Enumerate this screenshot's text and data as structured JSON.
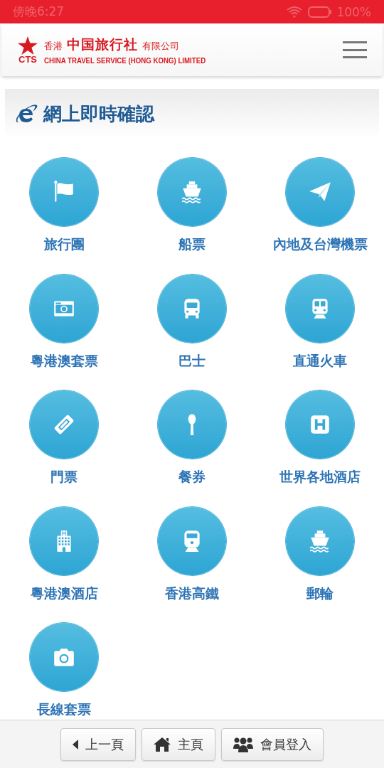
{
  "status_bar": {
    "time": "傍晚6:27",
    "battery": "100%"
  },
  "header": {
    "logo_mark": "CTS",
    "logo_prefix": "香港",
    "logo_name": "中国旅行社",
    "logo_suffix": "有限公司",
    "logo_english": "CHINA TRAVEL SERVICE (HONG KONG) LIMITED"
  },
  "section": {
    "title": "網上即時確認"
  },
  "services": [
    {
      "label": "旅行團",
      "kind": "flag"
    },
    {
      "label": "船票",
      "kind": "ship"
    },
    {
      "label": "內地及台灣機票",
      "kind": "plane"
    },
    {
      "label": "粵港澳套票",
      "kind": "card"
    },
    {
      "label": "巴士",
      "kind": "bus"
    },
    {
      "label": "直通火車",
      "kind": "train"
    },
    {
      "label": "門票",
      "kind": "ticket"
    },
    {
      "label": "餐券",
      "kind": "spoon"
    },
    {
      "label": "世界各地酒店",
      "kind": "hotel"
    },
    {
      "label": "粵港澳酒店",
      "kind": "building"
    },
    {
      "label": "香港高鐵",
      "kind": "rail"
    },
    {
      "label": "郵輪",
      "kind": "ship"
    },
    {
      "label": "長線套票",
      "kind": "camera"
    }
  ],
  "footer_buttons": [
    {
      "label": "上一頁",
      "kind": "back"
    },
    {
      "label": "主頁",
      "kind": "home"
    },
    {
      "label": "會員登入",
      "kind": "members"
    }
  ]
}
